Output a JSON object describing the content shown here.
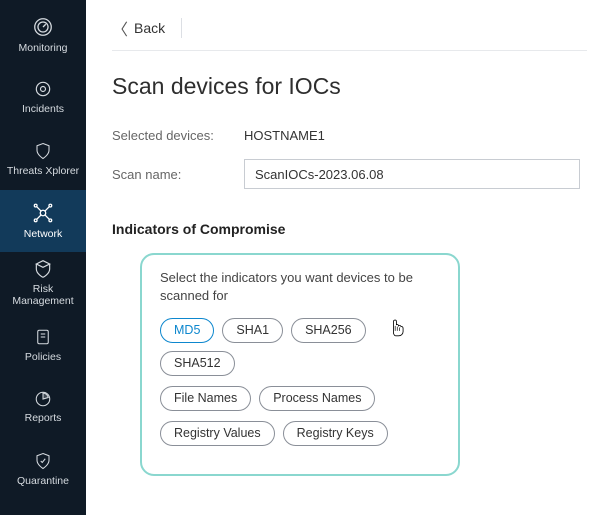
{
  "sidebar": {
    "items": [
      {
        "label": "Monitoring"
      },
      {
        "label": "Incidents"
      },
      {
        "label": "Threats Xplorer"
      },
      {
        "label": "Network"
      },
      {
        "label": "Risk Management"
      },
      {
        "label": "Policies"
      },
      {
        "label": "Reports"
      },
      {
        "label": "Quarantine"
      }
    ]
  },
  "back_label": "Back",
  "page_title": "Scan devices for IOCs",
  "selected_devices_label": "Selected devices:",
  "selected_devices_value": "HOSTNAME1",
  "scan_name_label": "Scan name:",
  "scan_name_value": "ScanIOCs-2023.06.08",
  "ioc_section_title": "Indicators of Compromise",
  "ioc_help": "Select the indicators you want devices to be scanned for",
  "ioc_chips": {
    "row1": [
      "MD5",
      "SHA1",
      "SHA256",
      "SHA512"
    ],
    "row2": [
      "File Names",
      "Process Names"
    ],
    "row3": [
      "Registry Values",
      "Registry Keys"
    ]
  }
}
